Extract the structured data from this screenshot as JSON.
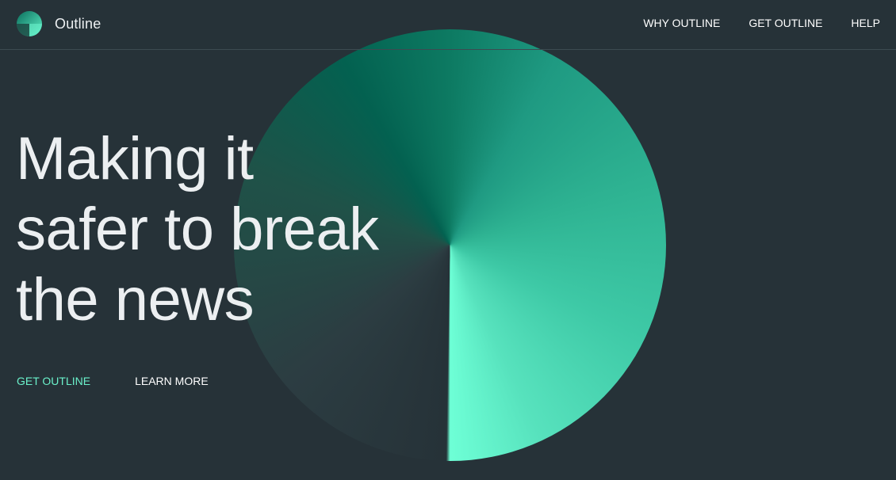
{
  "header": {
    "brand": "Outline",
    "logo_icon": "outline-logo-icon",
    "nav": [
      {
        "label": "WHY OUTLINE"
      },
      {
        "label": "GET OUTLINE"
      },
      {
        "label": "HELP"
      }
    ]
  },
  "hero": {
    "headline_lines": [
      "Making it",
      "safer to break",
      "the news"
    ],
    "primary_cta": "GET OUTLINE",
    "secondary_cta": "LEARN MORE"
  },
  "colors": {
    "background": "#263238",
    "accent": "#6bf2cb",
    "text": "#eceff1"
  }
}
